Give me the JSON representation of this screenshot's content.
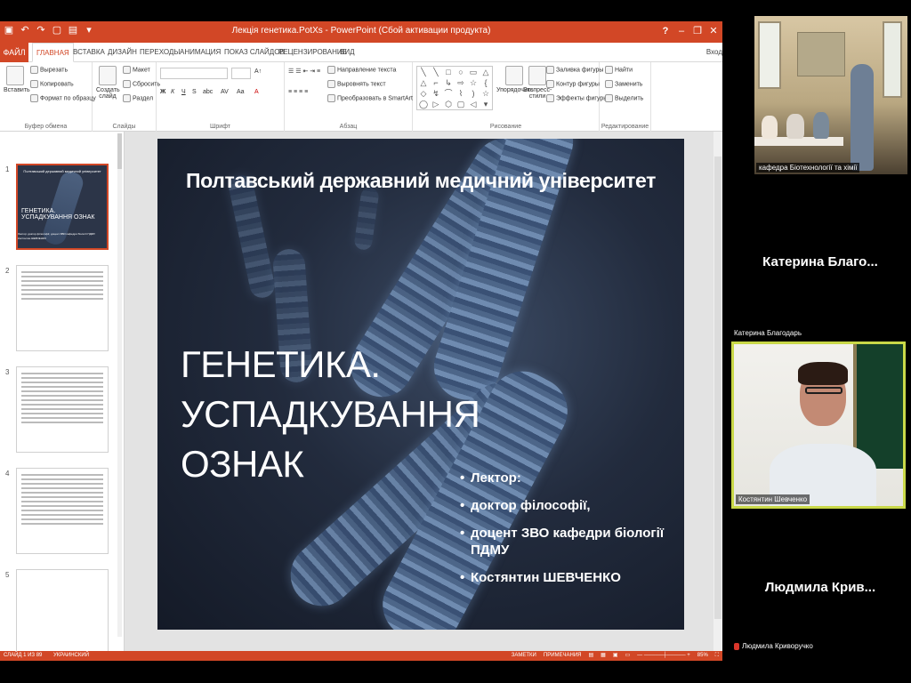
{
  "ppt": {
    "window_title": "Лекція генетика.PotXs - PowerPoint (Сбой активации продукта)",
    "quick_access": [
      "save-icon",
      "undo-icon",
      "redo-icon",
      "new-icon",
      "open-icon",
      "customize-icon"
    ],
    "window_controls": {
      "help": "?",
      "minimize": "–",
      "restore": "❐",
      "close": "✕"
    },
    "tabs": [
      "ФАЙЛ",
      "ГЛАВНАЯ",
      "ВСТАВКА",
      "ДИЗАЙН",
      "ПЕРЕХОДЫ",
      "АНИМАЦИЯ",
      "ПОКАЗ СЛАЙДОВ",
      "РЕЦЕНЗИРОВАНИЕ",
      "ВИД"
    ],
    "active_tab": "ГЛАВНАЯ",
    "account": "Вход",
    "ribbon": {
      "clipboard": {
        "paste": "Вставить",
        "cut": "Вырезать",
        "copy": "Копировать",
        "format_painter": "Формат по образцу",
        "group": "Буфер обмена"
      },
      "slides": {
        "new_slide": "Создать слайд",
        "layout": "Макет",
        "reset": "Сбросить",
        "section": "Раздел",
        "group": "Слайды"
      },
      "font": {
        "group": "Шрифт"
      },
      "paragraph": {
        "text_direction": "Направление текста",
        "align_text": "Выровнять текст",
        "smartart": "Преобразовать в SmartArt",
        "group": "Абзац"
      },
      "drawing": {
        "arrange": "Упорядочить",
        "quick_styles": "Экспресс-стили",
        "shape_fill": "Заливка фигуры",
        "shape_outline": "Контур фигуры",
        "shape_effects": "Эффекты фигуры",
        "group": "Рисование"
      },
      "editing": {
        "find": "Найти",
        "replace": "Заменить",
        "select": "Выделить",
        "group": "Редактирование"
      }
    },
    "thumbnails": [
      {
        "num": "1",
        "title": "Полтавський державний медичний університет",
        "text": "ГЕНЕТИКА. УСПАДКУВАННЯ ОЗНАК",
        "lector": "Лектор: доктор філософії, доцент ЗВО кафедри біології ПДМУ Костянтин ШЕВЧЕНКО"
      },
      {
        "num": "2"
      },
      {
        "num": "3"
      },
      {
        "num": "4"
      },
      {
        "num": "5"
      }
    ],
    "slide": {
      "university": "Полтавський державний медичний університет",
      "title_line1": "ГЕНЕТИКА. УСПАДКУВАННЯ",
      "title_line2": "ОЗНАК",
      "bullets": [
        "Лектор:",
        "доктор філософії,",
        "доцент ЗВО кафедри біології ПДМУ",
        "Костянтин ШЕВЧЕНКО"
      ]
    },
    "status": {
      "slide_info": "СЛАЙД 1 ИЗ 89",
      "language": "УКРАИНСКИЙ",
      "notes": "ЗАМЕТКИ",
      "comments": "ПРИМЕЧАНИЯ",
      "zoom": "85%"
    }
  },
  "participants": [
    {
      "label": "кафедра Біотехнології та хімії"
    },
    {
      "big": "Катерина Благо...",
      "label": "Катерина Благодарь"
    },
    {
      "label": "Костянтин Шевченко"
    },
    {
      "big": "Людмила Крив...",
      "label": "Людмила Криворучко"
    }
  ],
  "colors": {
    "ppt_accent": "#d24726",
    "active_speaker": "#c9d848",
    "slide_bg": "#1f2738"
  }
}
